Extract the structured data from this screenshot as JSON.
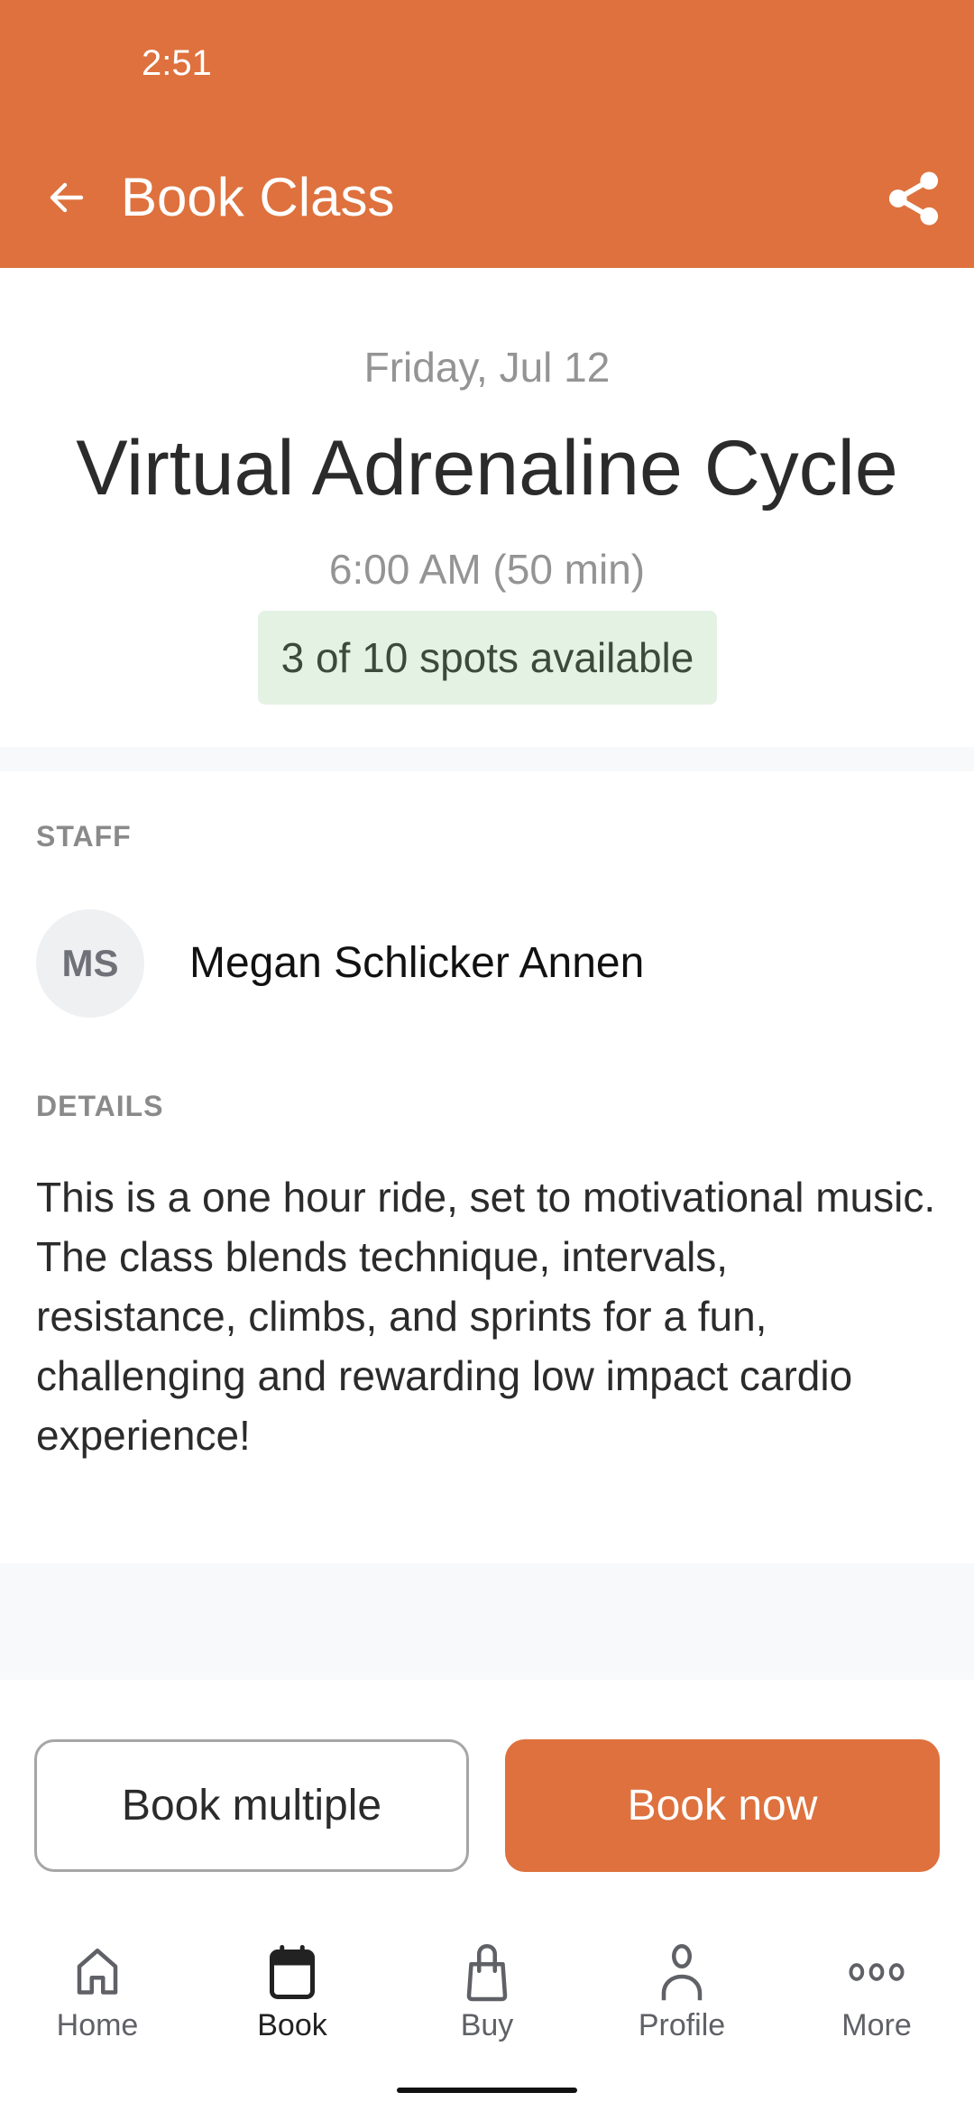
{
  "status_bar": {
    "time": "2:51"
  },
  "header": {
    "title": "Book Class",
    "back_icon": "arrow-left-icon",
    "share_icon": "share-icon",
    "background_color": "#DE713D"
  },
  "class": {
    "date": "Friday, Jul 12",
    "name": "Virtual Adrenaline Cycle",
    "time": "6:00 AM (50 min)",
    "availability": "3 of 10 spots available",
    "spots_available": 3,
    "spots_total": 10
  },
  "staff": {
    "label": "STAFF",
    "initials": "MS",
    "name": "Megan Schlicker Annen"
  },
  "details": {
    "label": "DETAILS",
    "text": "This is a one hour ride, set to motivational music. The class blends technique, intervals, resistance, climbs, and sprints for a fun, challenging and rewarding low impact cardio experience!"
  },
  "actions": {
    "book_multiple": "Book multiple",
    "book_now": "Book now"
  },
  "bottom_nav": {
    "active": "Book",
    "items": [
      {
        "label": "Home",
        "icon": "home-icon"
      },
      {
        "label": "Book",
        "icon": "calendar-icon"
      },
      {
        "label": "Buy",
        "icon": "shopping-bag-icon"
      },
      {
        "label": "Profile",
        "icon": "person-icon"
      },
      {
        "label": "More",
        "icon": "more-dots-icon"
      }
    ]
  }
}
